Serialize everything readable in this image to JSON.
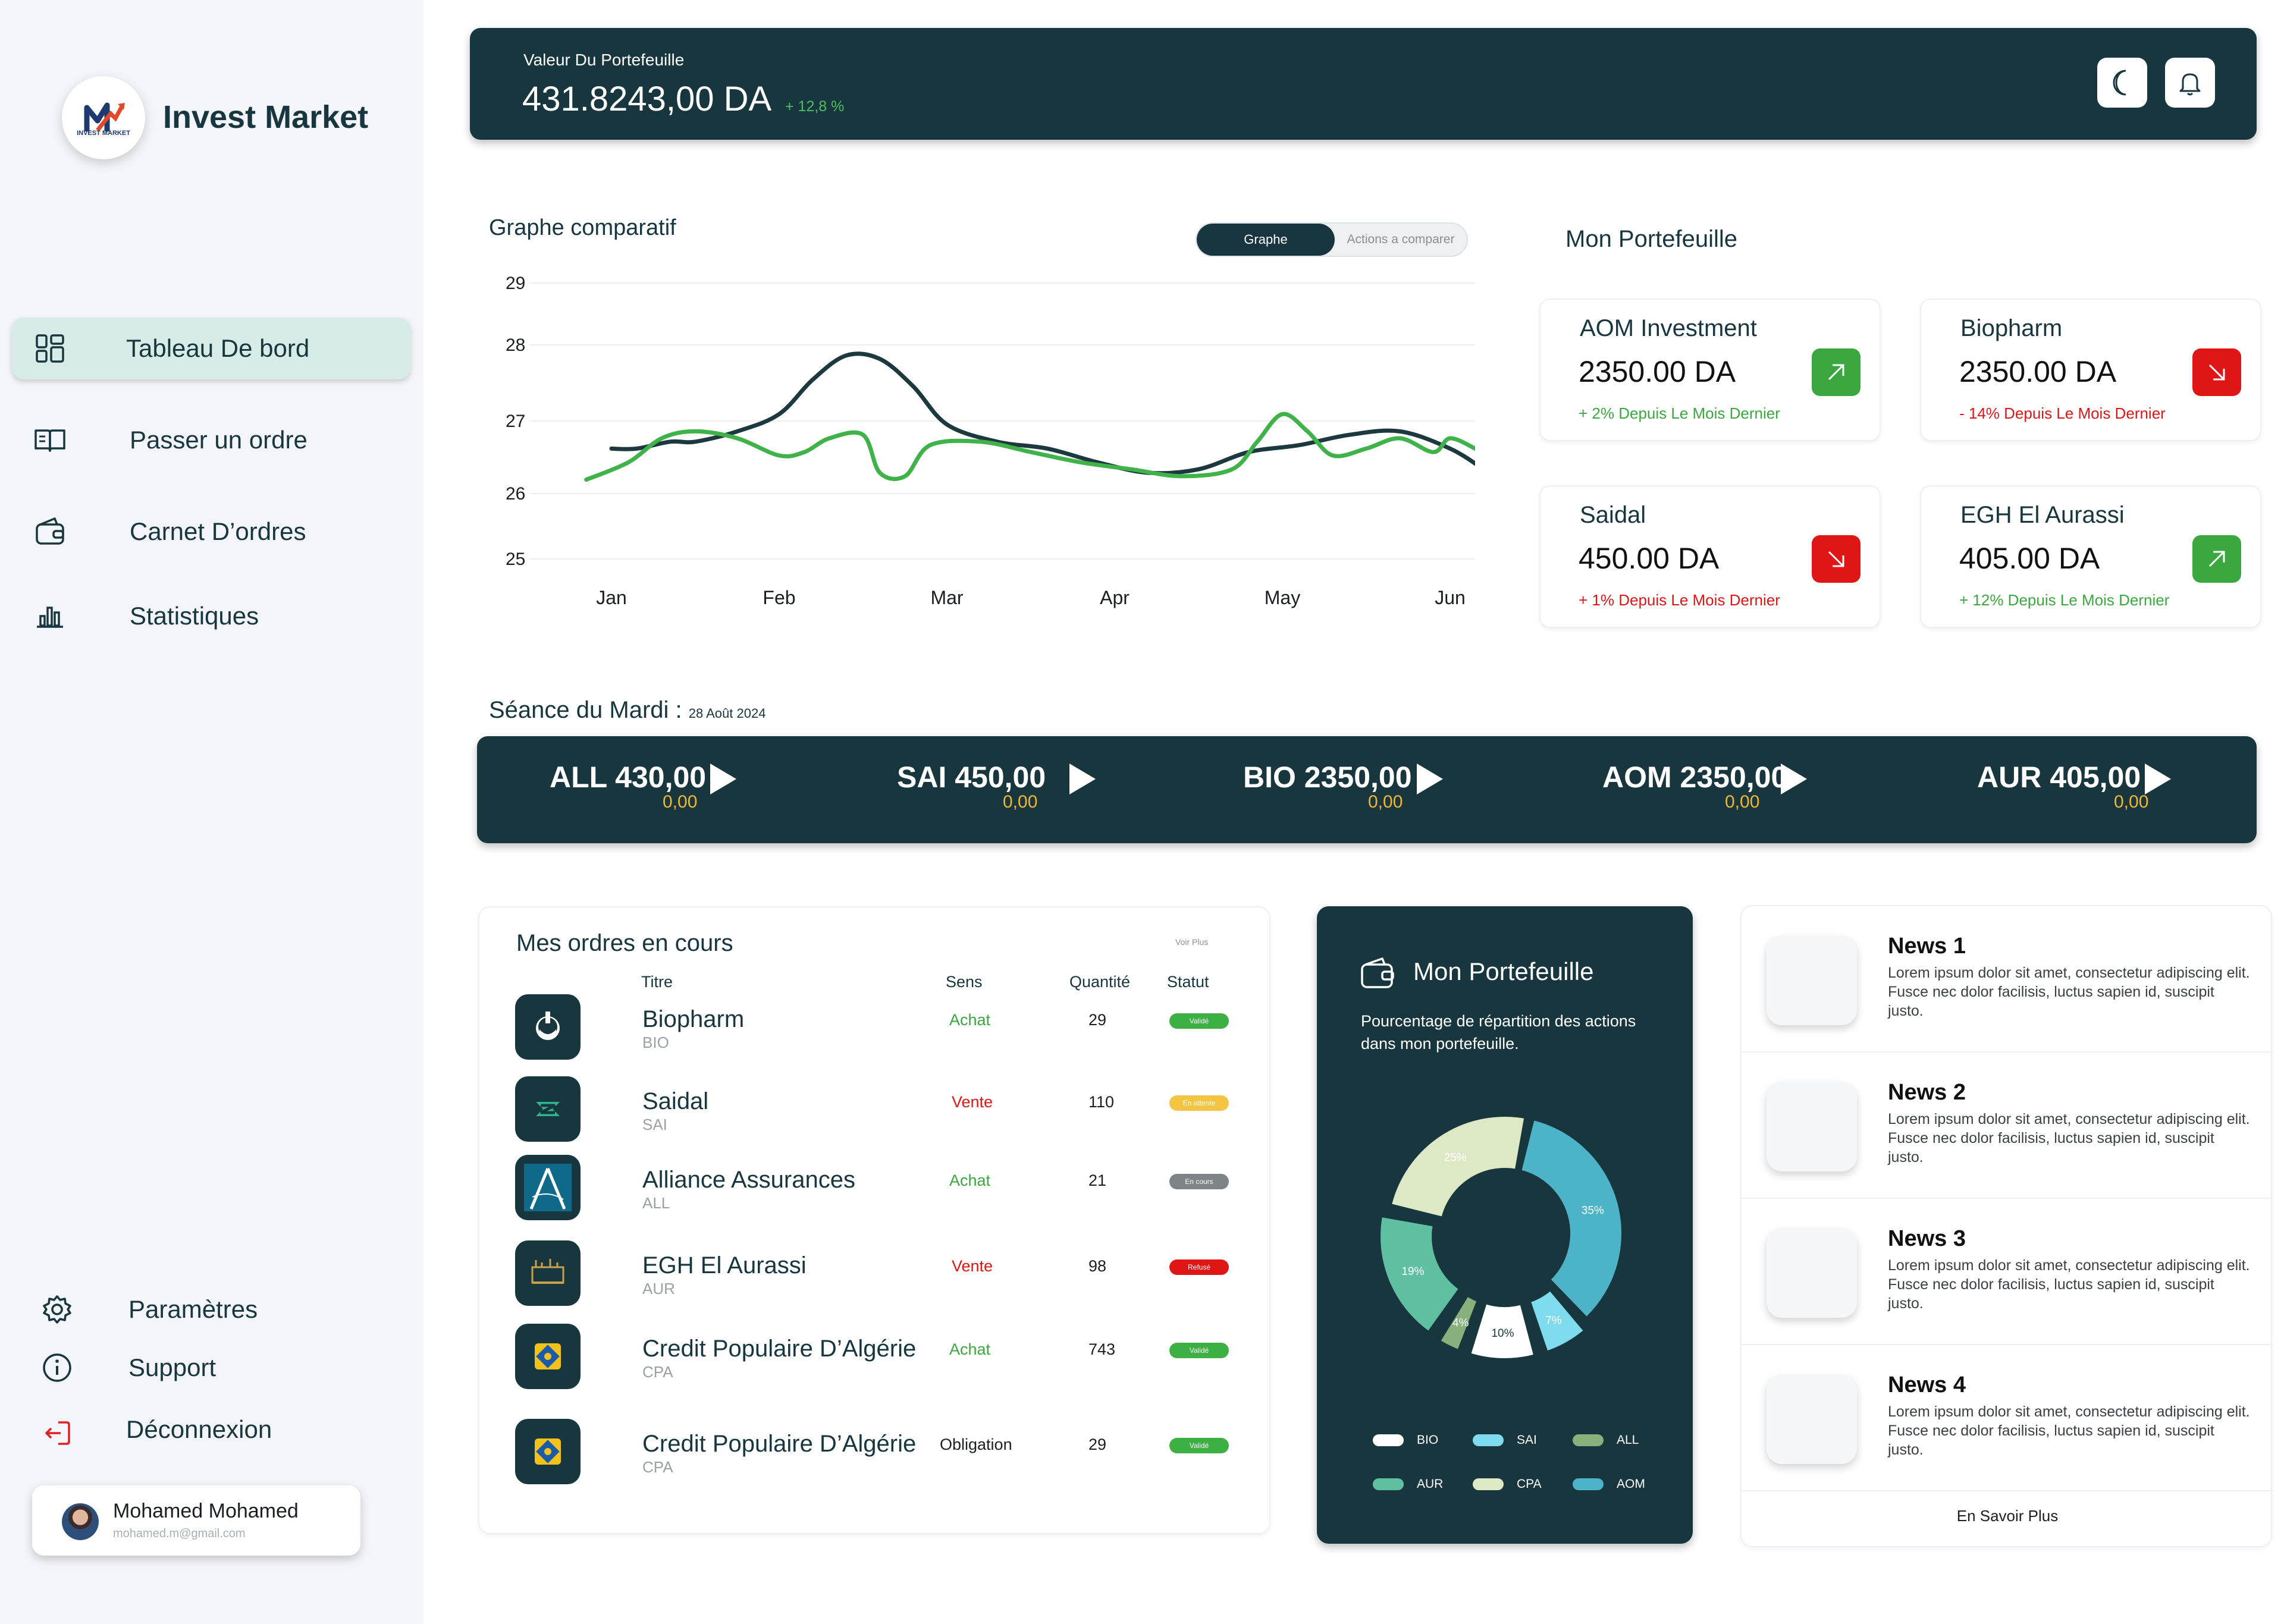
{
  "app": {
    "title": "Invest Market",
    "logo_text": "INVEST MARKET"
  },
  "nav": {
    "items": [
      {
        "label": "Tableau De bord",
        "icon": "dashboard-grid-icon",
        "active": true
      },
      {
        "label": "Passer un ordre",
        "icon": "book-icon"
      },
      {
        "label": "Carnet D’ordres",
        "icon": "wallet-icon"
      },
      {
        "label": "Statistiques",
        "icon": "bar-chart-icon"
      }
    ],
    "bottom": [
      {
        "label": "Paramètres",
        "icon": "gear-icon"
      },
      {
        "label": "Support",
        "icon": "info-icon"
      },
      {
        "label": "Déconnexion",
        "icon": "logout-icon",
        "color": "#e02020"
      }
    ]
  },
  "user": {
    "name": "Mohamed Mohamed",
    "email": "mohamed.m@gmail.com"
  },
  "header": {
    "label": "Valeur Du Portefeuille",
    "value": "431.8243,00 DA",
    "change": "+ 12,8 %"
  },
  "chart": {
    "title": "Graphe comparatif",
    "toggle": {
      "active": "Graphe",
      "inactive": "Actions a comparer"
    }
  },
  "chart_data": {
    "type": "line",
    "categories": [
      "Jan",
      "Feb",
      "Mar",
      "Apr",
      "May",
      "Jun"
    ],
    "yticks": [
      29,
      28,
      27,
      26,
      25
    ],
    "ylim": [
      25,
      29
    ],
    "grid": true,
    "legend": "none",
    "series": [
      {
        "color": "#1d3940",
        "x": [
          0.0,
          0.15,
          0.35,
          0.5,
          0.75,
          1.0,
          1.2,
          1.4,
          1.6,
          1.8,
          2.0,
          2.3,
          2.6,
          2.9,
          3.2,
          3.5,
          3.8,
          4.1,
          4.4,
          4.7,
          5.0,
          5.2
        ],
        "values": [
          26.6,
          26.6,
          26.7,
          26.7,
          26.85,
          27.1,
          27.6,
          27.95,
          27.9,
          27.5,
          26.95,
          26.7,
          26.6,
          26.4,
          26.25,
          26.3,
          26.55,
          26.65,
          26.8,
          26.85,
          26.6,
          26.3
        ]
      },
      {
        "color": "#3fb24a",
        "x": [
          -0.15,
          0.1,
          0.3,
          0.5,
          0.75,
          1.0,
          1.15,
          1.3,
          1.5,
          1.6,
          1.75,
          1.9,
          2.2,
          2.5,
          2.8,
          3.1,
          3.4,
          3.7,
          3.85,
          4.0,
          4.15,
          4.3,
          4.5,
          4.7,
          4.9,
          5.0,
          5.15
        ],
        "values": [
          26.15,
          26.4,
          26.75,
          26.85,
          26.75,
          26.5,
          26.55,
          26.75,
          26.8,
          26.25,
          26.2,
          26.65,
          26.7,
          26.55,
          26.4,
          26.3,
          26.2,
          26.3,
          26.7,
          27.1,
          26.85,
          26.5,
          26.6,
          26.75,
          26.55,
          26.75,
          26.6
        ]
      }
    ]
  },
  "portfolio": {
    "title": "Mon Portefeuille",
    "cards": [
      {
        "name": "AOM Investment",
        "value": "2350.00 DA",
        "change": "+ 2% Depuis Le Mois Dernier",
        "trend": "up",
        "color": "#3aa83f"
      },
      {
        "name": "Biopharm",
        "value": "2350.00 DA",
        "change": "- 14% Depuis Le Mois Dernier",
        "trend": "down",
        "color": "#e01616"
      },
      {
        "name": "Saidal",
        "value": "450.00 DA",
        "change": "+ 1% Depuis Le Mois Dernier",
        "trend": "down",
        "color": "#e01616"
      },
      {
        "name": "EGH El Aurassi",
        "value": "405.00 DA",
        "change": "+ 12% Depuis Le Mois Dernier",
        "trend": "up",
        "color": "#3aa83f"
      }
    ]
  },
  "seance": {
    "title": "Séance du Mardi : ",
    "date": "28 Août 2024",
    "tickers": [
      {
        "label": "ALL 430,00",
        "sub": "0,00"
      },
      {
        "label": "SAI 450,00",
        "sub": "0,00"
      },
      {
        "label": "BIO 2350,00",
        "sub": "0,00"
      },
      {
        "label": "AOM 2350,00",
        "sub": "0,00"
      },
      {
        "label": "AUR 405,00",
        "sub": "0,00"
      }
    ]
  },
  "orders": {
    "title": "Mes ordres en cours",
    "more": "Voir Plus",
    "headers": {
      "titre": "Titre",
      "sens": "Sens",
      "quantite": "Quantité",
      "statut": "Statut"
    },
    "rows": [
      {
        "name": "Biopharm",
        "code": "BIO",
        "sens": "Achat",
        "sens_color": "#3aa83f",
        "qty": "29",
        "status": "Validé",
        "status_color": "#3cb043",
        "logo": "biopharm-logo-icon"
      },
      {
        "name": "Saidal",
        "code": "SAI",
        "sens": "Vente",
        "sens_color": "#e01616",
        "qty": "110",
        "status": "En attente",
        "status_color": "#f4c542",
        "logo": "saidal-logo-icon"
      },
      {
        "name": "Alliance Assurances",
        "code": "ALL",
        "sens": "Achat",
        "sens_color": "#3aa83f",
        "qty": "21",
        "status": "En cours",
        "status_color": "#7d8387",
        "logo": "alliance-logo-icon"
      },
      {
        "name": "EGH El Aurassi",
        "code": "AUR",
        "sens": "Vente",
        "sens_color": "#e01616",
        "qty": "98",
        "status": "Refusé",
        "status_color": "#e01616",
        "logo": "aurassi-logo-icon"
      },
      {
        "name": "Credit Populaire D’Algérie",
        "code": "CPA",
        "sens": "Achat",
        "sens_color": "#3aa83f",
        "qty": "743",
        "status": "Validé",
        "status_color": "#3cb043",
        "logo": "cpa-logo-icon"
      },
      {
        "name": "Credit Populaire D’Algérie",
        "code": "CPA",
        "sens": "Obligation",
        "sens_color": "#1b1f24",
        "qty": "29",
        "status": "Validé",
        "status_color": "#3cb043",
        "logo": "cpa-logo-icon"
      }
    ]
  },
  "donut": {
    "title": "Mon Portefeuille",
    "desc": "Pourcentage de répartition des actions dans mon portefeuille.",
    "slices": [
      {
        "name": "AOM",
        "pct": 35,
        "label": "35%",
        "color": "#4db3c7"
      },
      {
        "name": "SAI",
        "pct": 7,
        "label": "7%",
        "color": "#7fdcee"
      },
      {
        "name": "BIO",
        "pct": 10,
        "label": "10%",
        "color": "#ffffff"
      },
      {
        "name": "ALL",
        "pct": 4,
        "label": "4%",
        "color": "#88b07d"
      },
      {
        "name": "AUR",
        "pct": 19,
        "label": "19%",
        "color": "#5fc0a1"
      },
      {
        "name": "CPA",
        "pct": 25,
        "label": "25%",
        "color": "#dde8c4"
      }
    ],
    "legend": [
      {
        "name": "BIO",
        "color": "#ffffff"
      },
      {
        "name": "SAI",
        "color": "#7fdcee"
      },
      {
        "name": "ALL",
        "color": "#88b07d"
      },
      {
        "name": "AUR",
        "color": "#5fc0a1"
      },
      {
        "name": "CPA",
        "color": "#dde8c4"
      },
      {
        "name": "AOM",
        "color": "#4db3c7"
      }
    ]
  },
  "news": {
    "items": [
      {
        "title": "News 1",
        "body": "Lorem ipsum dolor sit amet, consectetur adipiscing elit. Fusce nec dolor facilisis, luctus sapien id, suscipit justo."
      },
      {
        "title": "News 2",
        "body": "Lorem ipsum dolor sit amet, consectetur adipiscing elit. Fusce nec dolor facilisis, luctus sapien id, suscipit justo."
      },
      {
        "title": "News 3",
        "body": "Lorem ipsum dolor sit amet, consectetur adipiscing elit. Fusce nec dolor facilisis, luctus sapien id, suscipit justo."
      },
      {
        "title": "News 4",
        "body": "Lorem ipsum dolor sit amet, consectetur adipiscing elit. Fusce nec dolor facilisis, luctus sapien id, suscipit justo."
      }
    ],
    "more": "En Savoir Plus"
  }
}
